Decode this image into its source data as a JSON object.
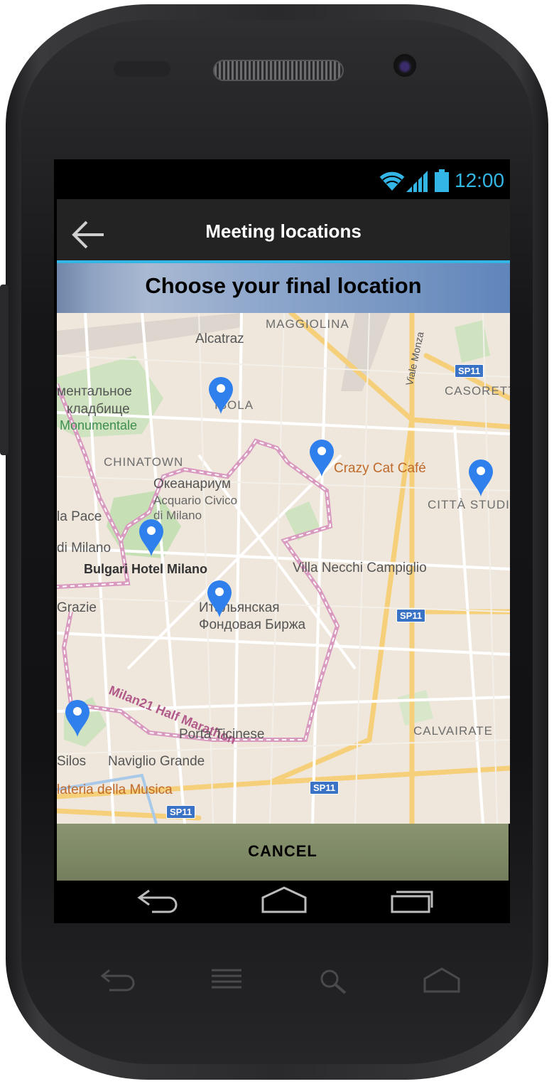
{
  "statusbar": {
    "time": "12:00"
  },
  "actionbar": {
    "title": "Meeting locations"
  },
  "banner": {
    "text": "Choose your final location"
  },
  "map": {
    "labels": {
      "maggiolina": "MAGGIOLINA",
      "alcatraz": "Alcatraz",
      "viale_monza": "Viale Monza",
      "casorett": "CASORETT",
      "cemetery_ru_1": "ментальное",
      "cemetery_ru_2": "кладбище",
      "monumentale": "Monumentale",
      "isola": "ISOLA",
      "chinatown": "CHINATOWN",
      "aquarium_ru": "Океанариум",
      "aquarium_it_1": "Acquario Civico",
      "aquarium_it_2": "di Milano",
      "crazy_cat": "Crazy Cat Café",
      "citta_studi": "CITTÀ STUDI",
      "pace": "la Pace",
      "di_milano": "di Milano",
      "bulgari": "Bulgari Hotel Milano",
      "villa_necchi": "Villa Necchi Campiglio",
      "grazie": "Grazie",
      "borsa_ru_1": "Итальянская",
      "borsa_ru_2": "Фондовая Биржа",
      "route": "Milan21 Half Marathon",
      "porta_ticinese": "Porta Ticinese",
      "calvairate": "CALVAIRATE",
      "silos": "Silos",
      "naviglio": "Naviglio Grande",
      "musica": "lateria della Musica"
    },
    "highways": {
      "sp11_a": "SP11",
      "sp11_b": "SP11",
      "sp11_c": "SP11",
      "sp11_d": "SP11"
    }
  },
  "cancel": {
    "label": "CANCEL"
  },
  "colors": {
    "accent": "#33b5e5",
    "pin": "#2f7fec",
    "cancel_bar": "#7f8a66"
  },
  "icons": [
    "wifi-icon",
    "signal-icon",
    "battery-icon",
    "back-arrow-icon",
    "location-pin-icon",
    "nav-back-icon",
    "nav-home-icon",
    "nav-recents-icon"
  ]
}
